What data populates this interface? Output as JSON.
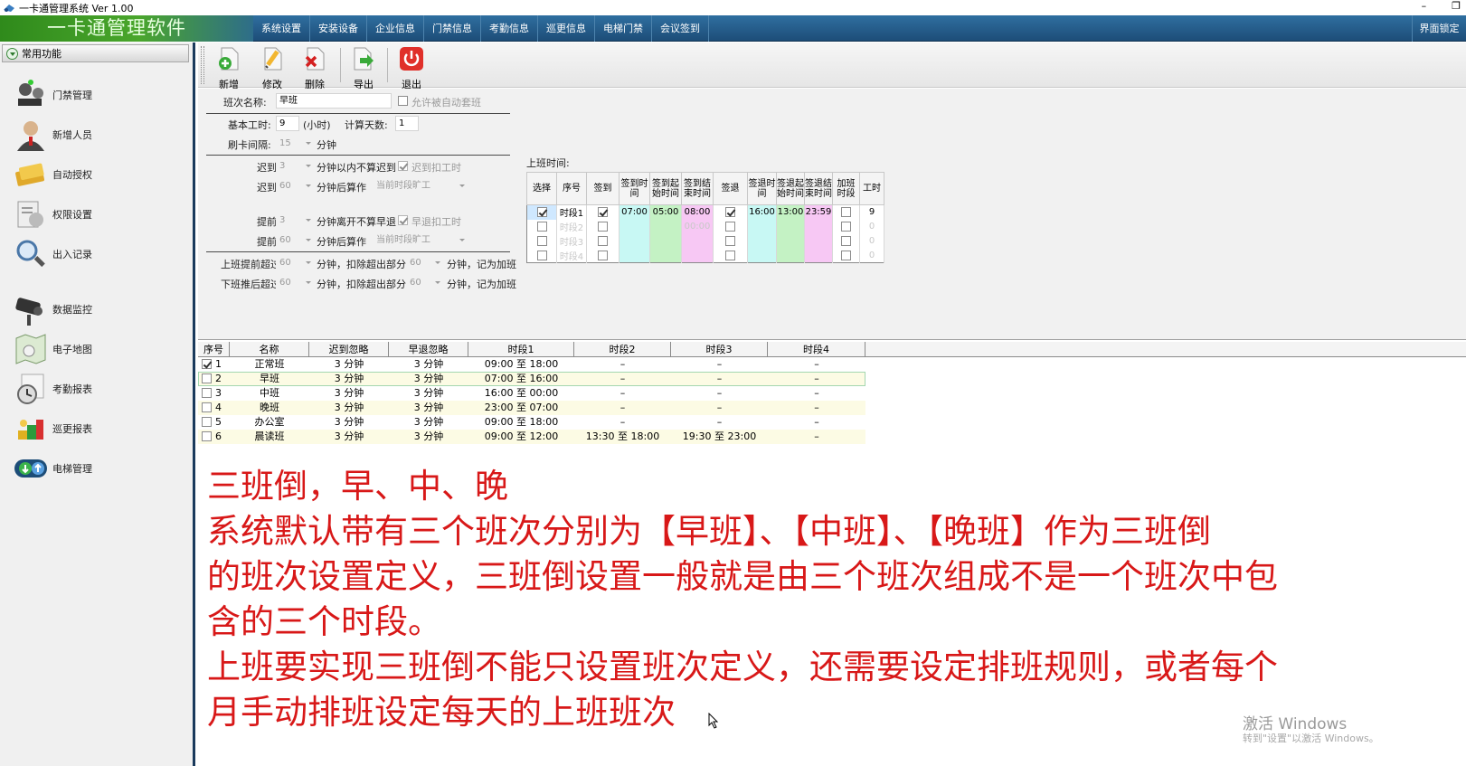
{
  "window": {
    "title": "一卡通管理系统  Ver 1.00",
    "minimize": "–",
    "restore": "❐"
  },
  "menubar": {
    "brand": "一卡通管理软件",
    "items": [
      "系统设置",
      "安装设备",
      "企业信息",
      "门禁信息",
      "考勤信息",
      "巡更信息",
      "电梯门禁",
      "会议签到"
    ],
    "lock": "界面锁定"
  },
  "sidebar": {
    "header": "常用功能",
    "items": [
      "门禁管理",
      "新增人员",
      "自动授权",
      "权限设置",
      "出入记录",
      "数据监控",
      "电子地图",
      "考勤报表",
      "巡更报表",
      "电梯管理"
    ]
  },
  "toolbar": {
    "add": "新增",
    "edit": "修改",
    "delete": "删除",
    "export": "导出",
    "exit": "退出"
  },
  "form": {
    "shift_name_label": "班次名称:",
    "shift_name_value": "早班",
    "auto_shift_label": "允许被自动套班",
    "base_hours_label": "基本工时:",
    "base_hours_value": "9",
    "hours_unit": "(小时)",
    "days_label": "计算天数:",
    "days_value": "1",
    "interval_label": "刷卡间隔:",
    "interval_value": "15",
    "minute": "分钟",
    "late_label": "迟到",
    "late1_value": "3",
    "late1_text": "分钟以内不算迟到",
    "late_deduct": "迟到扣工时",
    "late2_value": "60",
    "after_text": "分钟后算作",
    "absent_placeholder": "当前时段旷工",
    "early_label": "提前",
    "early1_value": "3",
    "early1_text": "分钟离开不算早退",
    "early_deduct": "早退扣工时",
    "early2_value": "60",
    "ot_before_label": "上班提前超过",
    "ot_before_value": "60",
    "ot_mid_text": "分钟，扣除超出部分",
    "ot_before_value2": "60",
    "ot_end_text": "分钟，记为加班",
    "ot_after_label": "下班推后超过",
    "ot_after_value": "60",
    "ot_after_value2": "60"
  },
  "time_grid": {
    "title": "上班时间:",
    "headers": [
      "选择",
      "序号",
      "签到",
      "签到时间",
      "签到起始时间",
      "签到结束时间",
      "签退",
      "签退时间",
      "签退起始时间",
      "签退结束时间",
      "加班时段",
      "工时"
    ],
    "rows": [
      {
        "checked": true,
        "seq": "时段1",
        "in": true,
        "in_time": "07:00",
        "in_start": "05:00",
        "in_end": "08:00",
        "out": true,
        "out_time": "16:00",
        "out_start": "13:00",
        "out_end": "23:59",
        "ot": false,
        "hours": "9"
      },
      {
        "checked": false,
        "seq": "时段2",
        "in": false,
        "in_time": "",
        "in_start": "",
        "in_end": "00:00",
        "out": false,
        "out_time": "",
        "out_start": "",
        "out_end": "",
        "ot": false,
        "hours": "0"
      },
      {
        "checked": false,
        "seq": "时段3",
        "in": false,
        "in_time": "",
        "in_start": "",
        "in_end": "",
        "out": false,
        "out_time": "",
        "out_start": "",
        "out_end": "",
        "ot": false,
        "hours": "0"
      },
      {
        "checked": false,
        "seq": "时段4",
        "in": false,
        "in_time": "",
        "in_start": "",
        "in_end": "",
        "out": false,
        "out_time": "",
        "out_start": "",
        "out_end": "",
        "ot": false,
        "hours": "0"
      }
    ]
  },
  "shift_table": {
    "headers": [
      "序号",
      "名称",
      "迟到忽略",
      "早退忽略",
      "时段1",
      "时段2",
      "时段3",
      "时段4"
    ],
    "rows": [
      {
        "checked": true,
        "no": "1",
        "name": "正常班",
        "late": "3 分钟",
        "early": "3 分钟",
        "p1": "09:00  至  18:00",
        "p2": "–",
        "p3": "–",
        "p4": "–"
      },
      {
        "checked": false,
        "no": "2",
        "name": "早班",
        "late": "3 分钟",
        "early": "3 分钟",
        "p1": "07:00  至  16:00",
        "p2": "–",
        "p3": "–",
        "p4": "–"
      },
      {
        "checked": false,
        "no": "3",
        "name": "中班",
        "late": "3 分钟",
        "early": "3 分钟",
        "p1": "16:00  至  00:00",
        "p2": "–",
        "p3": "–",
        "p4": "–"
      },
      {
        "checked": false,
        "no": "4",
        "name": "晚班",
        "late": "3 分钟",
        "early": "3 分钟",
        "p1": "23:00  至  07:00",
        "p2": "–",
        "p3": "–",
        "p4": "–"
      },
      {
        "checked": false,
        "no": "5",
        "name": "办公室",
        "late": "3 分钟",
        "early": "3 分钟",
        "p1": "09:00  至  18:00",
        "p2": "–",
        "p3": "–",
        "p4": "–"
      },
      {
        "checked": false,
        "no": "6",
        "name": "晨读班",
        "late": "3 分钟",
        "early": "3 分钟",
        "p1": "09:00  至  12:00",
        "p2": "13:30  至  18:00",
        "p3": "19:30  至  23:00",
        "p4": "–"
      }
    ]
  },
  "caption": {
    "line1": "三班倒，早、中、晚",
    "line2": "系统默认带有三个班次分别为【早班】、【中班】、【晚班】作为三班倒",
    "line3": "的班次设置定义，三班倒设置一般就是由三个班次组成不是一个班次中包",
    "line4": "含的三个时段。",
    "line5": "上班要实现三班倒不能只设置班次定义，还需要设定排班规则，或者每个",
    "line6": "月手动排班设定每天的上班班次"
  },
  "watermark": {
    "line1": "激活 Windows",
    "line2": "转到\"设置\"以激活 Windows。"
  },
  "colors": {
    "menubar": "#1d4d78",
    "brand_green": "#4aa62c",
    "caption_red": "#d81818",
    "cyan_cell": "#c8f8f4",
    "green_cell": "#c4f2c4",
    "pink_cell": "#f7c8f4"
  }
}
